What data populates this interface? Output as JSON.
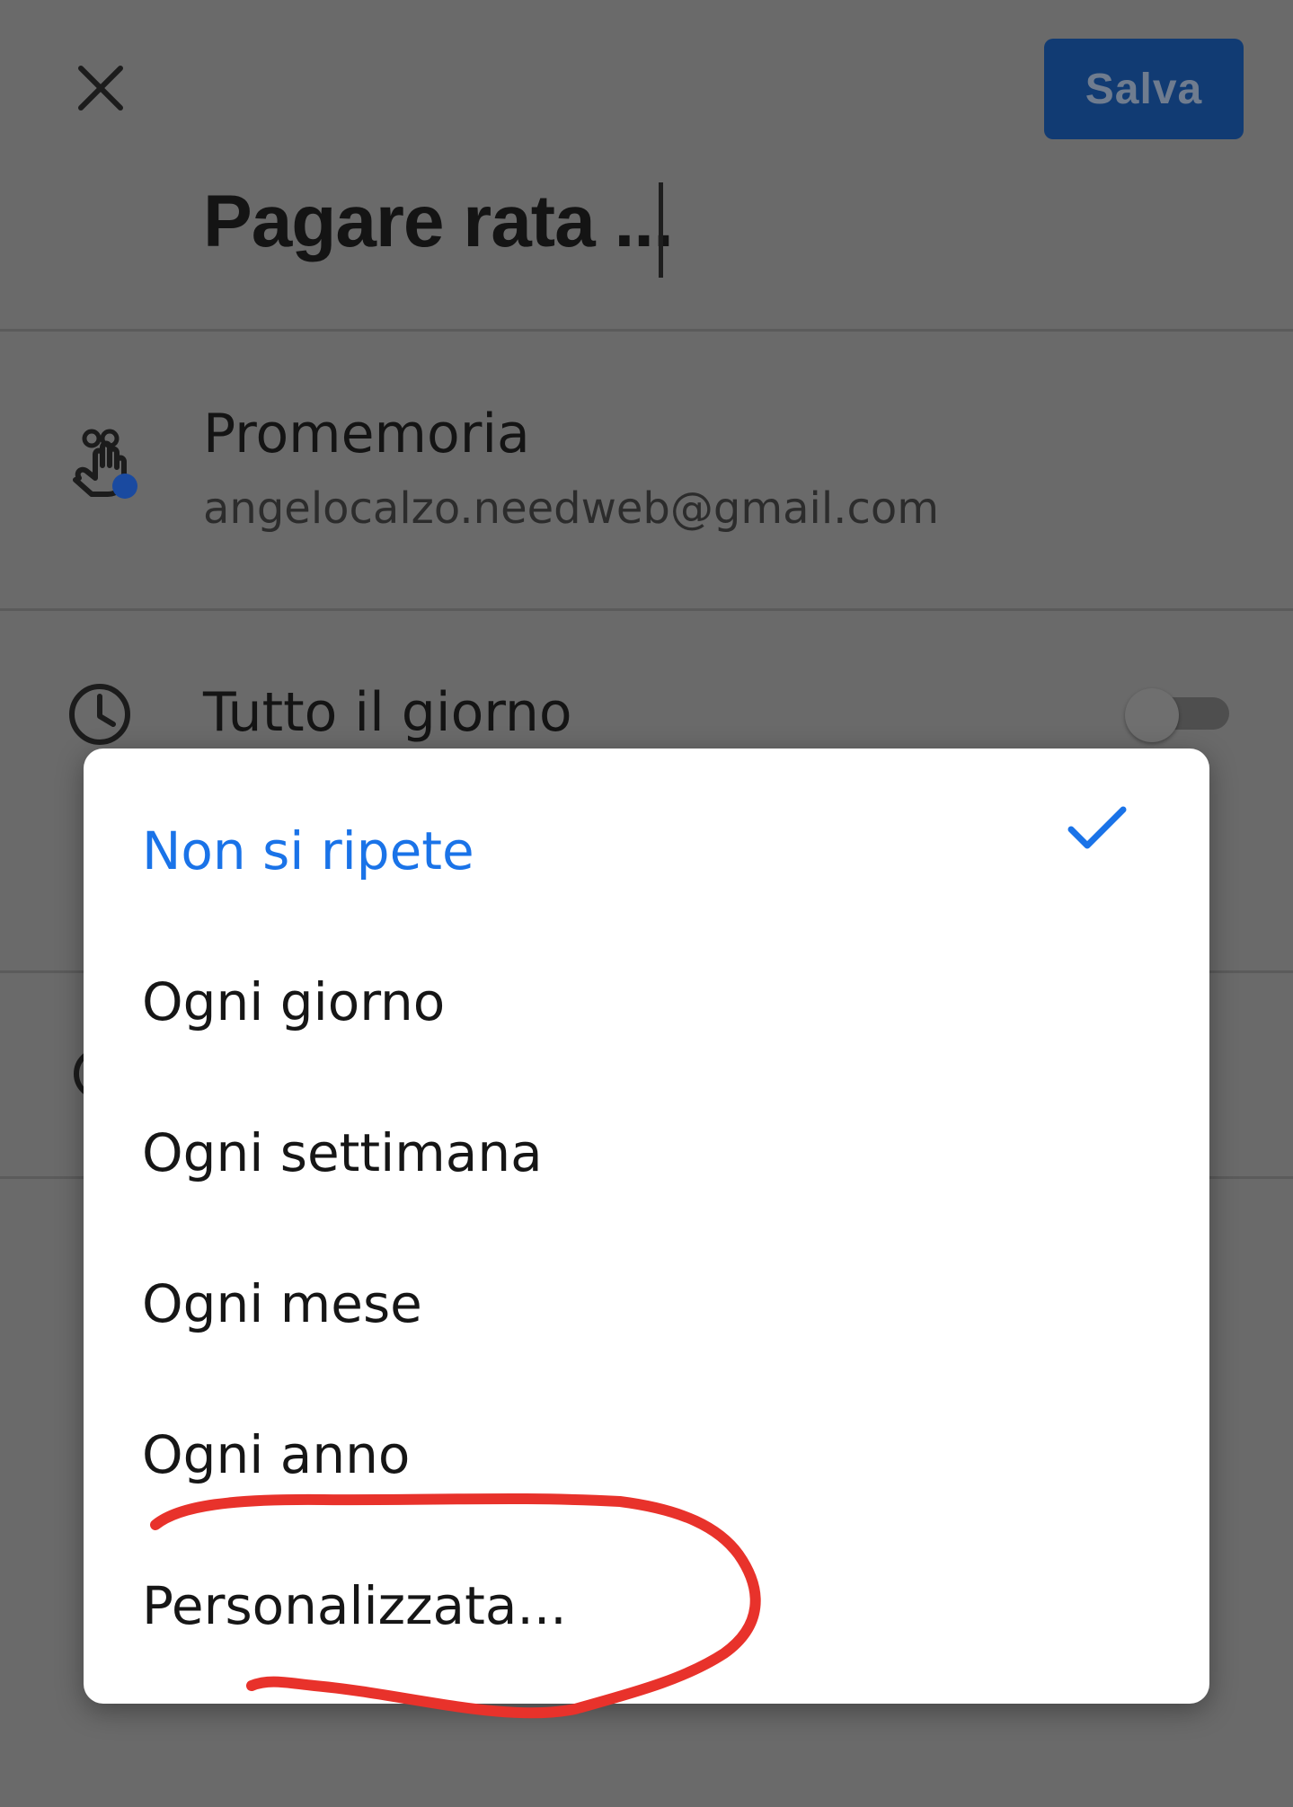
{
  "header": {
    "save_label": "Salva",
    "title_value": "Pagare rata ..."
  },
  "reminder": {
    "label": "Promemoria",
    "account": "angelocalzo.needweb@gmail.com"
  },
  "all_day": {
    "label": "Tutto il giorno",
    "enabled": false
  },
  "repeat_menu": {
    "items": [
      {
        "label": "Non si ripete",
        "selected": true
      },
      {
        "label": "Ogni giorno",
        "selected": false
      },
      {
        "label": "Ogni settimana",
        "selected": false
      },
      {
        "label": "Ogni mese",
        "selected": false
      },
      {
        "label": "Ogni anno",
        "selected": false
      },
      {
        "label": "Personalizzata...",
        "selected": false
      }
    ]
  },
  "colors": {
    "accent": "#1a73e8",
    "save_button_bg": "#113b73",
    "scrim": "#6a6a6a",
    "annotation_stroke": "#e8322b",
    "status_dot": "#1a4aa0"
  },
  "icons": {
    "close": "close-icon",
    "reminder": "reminder-hand-icon",
    "clock": "clock-icon",
    "check": "checkmark-icon"
  }
}
